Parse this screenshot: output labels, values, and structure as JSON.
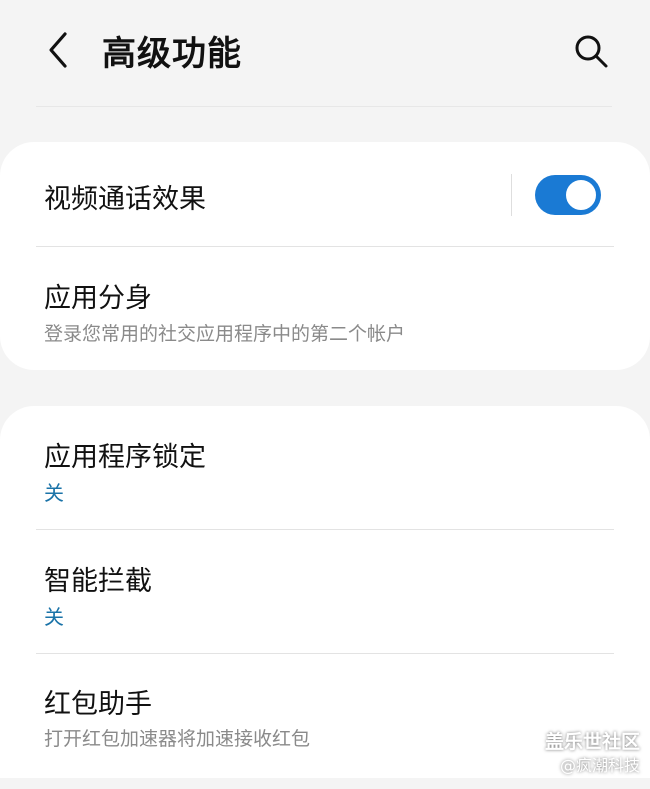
{
  "header": {
    "title": "高级功能",
    "back_icon": "chevron-left-icon",
    "search_icon": "search-icon"
  },
  "group1": {
    "video_call_effects": {
      "title": "视频通话效果",
      "toggle_on": true
    },
    "dual_messenger": {
      "title": "应用分身",
      "subtitle": "登录您常用的社交应用程序中的第二个帐户"
    }
  },
  "group2": {
    "app_lock": {
      "title": "应用程序锁定",
      "status": "关"
    },
    "smart_block": {
      "title": "智能拦截",
      "status": "关"
    },
    "red_packet": {
      "title": "红包助手",
      "subtitle": "打开红包加速器将加速接收红包"
    }
  },
  "watermark": {
    "line1": "盖乐世社区",
    "line2": "@疯潮科技"
  },
  "colors": {
    "accent": "#1a7ad4",
    "status_text": "#1a73a8",
    "background": "#f4f4f4",
    "card": "#ffffff"
  }
}
